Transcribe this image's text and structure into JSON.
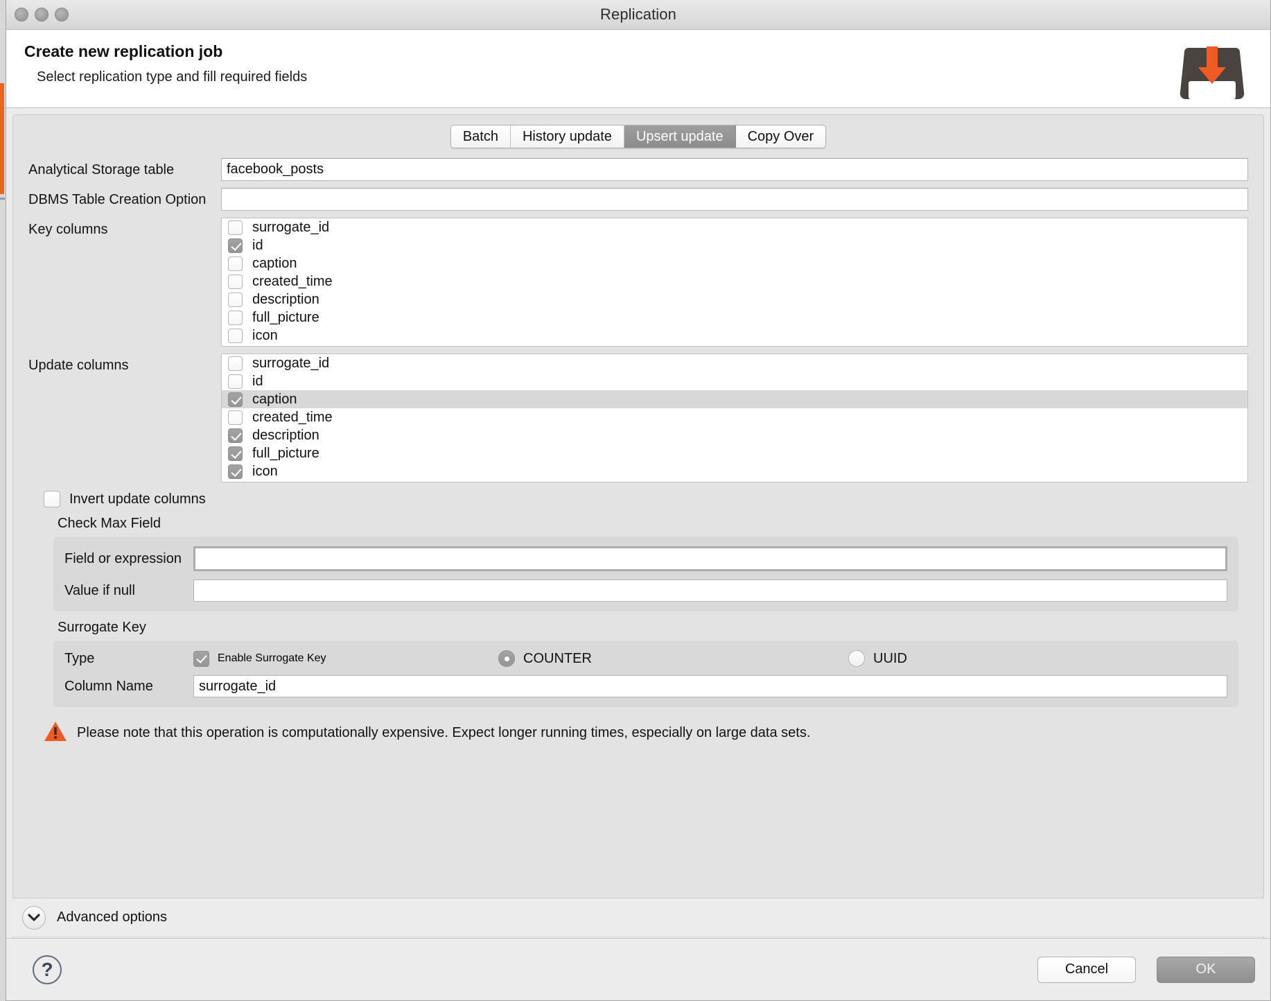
{
  "window": {
    "title": "Replication",
    "traffic_lights": [
      "close",
      "minimize",
      "zoom"
    ]
  },
  "header": {
    "title": "Create new replication job",
    "subtitle": "Select replication type and fill required fields",
    "icon": "inbox-download-icon",
    "icon_arrow_color": "#f15a22",
    "icon_body_color": "#4a4440"
  },
  "tabs": [
    {
      "label": "Batch",
      "active": false
    },
    {
      "label": "History update",
      "active": false
    },
    {
      "label": "Upsert update",
      "active": true
    },
    {
      "label": "Copy Over",
      "active": false
    }
  ],
  "form": {
    "analytical_storage_table": {
      "label": "Analytical Storage table",
      "value": "facebook_posts",
      "placeholder": ""
    },
    "dbms_table_creation_option": {
      "label": "DBMS Table Creation Option",
      "value": "",
      "placeholder": ""
    },
    "key_columns": {
      "label": "Key columns",
      "items": [
        {
          "label": "surrogate_id",
          "checked": false,
          "selected": false
        },
        {
          "label": "id",
          "checked": true,
          "selected": false
        },
        {
          "label": "caption",
          "checked": false,
          "selected": false
        },
        {
          "label": "created_time",
          "checked": false,
          "selected": false
        },
        {
          "label": "description",
          "checked": false,
          "selected": false
        },
        {
          "label": "full_picture",
          "checked": false,
          "selected": false
        },
        {
          "label": "icon",
          "checked": false,
          "selected": false
        }
      ]
    },
    "update_columns": {
      "label": "Update columns",
      "items": [
        {
          "label": "surrogate_id",
          "checked": false,
          "selected": false
        },
        {
          "label": "id",
          "checked": false,
          "selected": false
        },
        {
          "label": "caption",
          "checked": true,
          "selected": true
        },
        {
          "label": "created_time",
          "checked": false,
          "selected": false
        },
        {
          "label": "description",
          "checked": true,
          "selected": false
        },
        {
          "label": "full_picture",
          "checked": true,
          "selected": false
        },
        {
          "label": "icon",
          "checked": true,
          "selected": false
        }
      ]
    },
    "invert_update_columns": {
      "label": "Invert update columns",
      "checked": false
    }
  },
  "check_max_field": {
    "title": "Check Max Field",
    "field_or_expression": {
      "label": "Field or expression",
      "value": "",
      "placeholder": "",
      "focused": true
    },
    "value_if_null": {
      "label": "Value if null",
      "value": "",
      "placeholder": ""
    }
  },
  "surrogate_key": {
    "title": "Surrogate Key",
    "type_label": "Type",
    "enable": {
      "label": "Enable Surrogate Key",
      "checked": true
    },
    "options": [
      {
        "label": "COUNTER",
        "selected": true
      },
      {
        "label": "UUID",
        "selected": false
      }
    ],
    "column_name": {
      "label": "Column Name",
      "value": "surrogate_id",
      "placeholder": ""
    }
  },
  "warning": {
    "icon": "warning-triangle-icon",
    "icon_color": "#f15a22",
    "text": "Please note that this operation is computationally expensive. Expect longer running times, especially on large data sets."
  },
  "advanced": {
    "label": "Advanced options",
    "icon": "chevron-down-icon",
    "expanded": false
  },
  "footer": {
    "help_label": "?",
    "cancel_label": "Cancel",
    "ok_label": "OK"
  }
}
